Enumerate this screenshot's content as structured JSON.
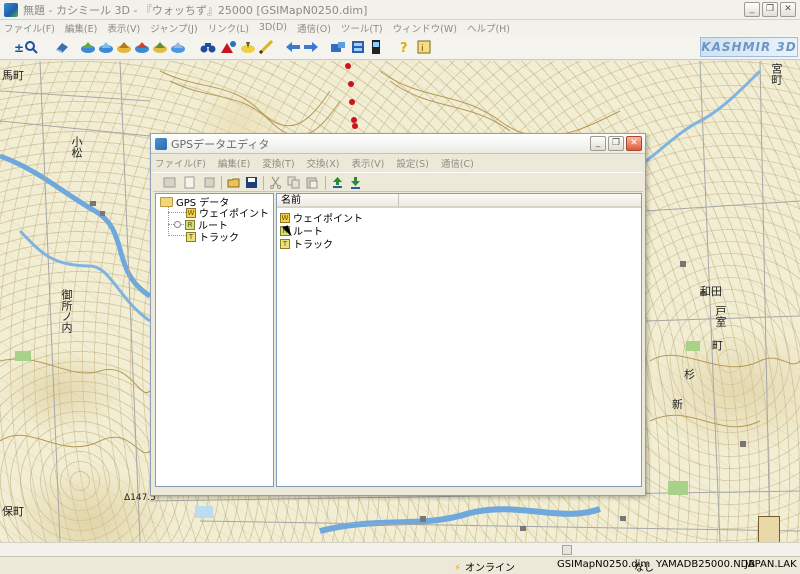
{
  "window": {
    "title": "無題 - カシミール 3D - 『ウォッちず』25000 [GSIMapN0250.dim]",
    "buttons": [
      "_",
      "❐",
      "✕"
    ]
  },
  "menu": [
    "ファイル(F)",
    "編集(E)",
    "表示(V)",
    "ジャンプ(J)",
    "リンク(L)",
    "3D(D)",
    "通信(O)",
    "ツール(T)",
    "ウィンドウ(W)",
    "ヘルプ(H)"
  ],
  "brand": "KASHMIR 3D",
  "map": {
    "labels": [
      "馬町",
      "小松",
      "御所ノ内",
      "保町",
      "宮町",
      "和田",
      "戸室",
      "町",
      "Δ147.5",
      "杉",
      "新"
    ]
  },
  "dialog": {
    "title": "GPSデータエディタ",
    "menu": [
      "ファイル(F)",
      "編集(E)",
      "変換(T)",
      "交換(X)",
      "表示(V)",
      "設定(S)",
      "通信(C)"
    ],
    "tree": {
      "root": "GPS データ",
      "children": [
        "ウェイポイント",
        "ルート",
        "トラック"
      ]
    },
    "list": {
      "column_header": "名前",
      "rows": [
        "ウェイポイント",
        "ルート",
        "トラック"
      ]
    }
  },
  "status": {
    "connection": "オンライン",
    "file": "GSIMapN0250.dim",
    "none": "なし",
    "db": "YAMADB25000.NDB",
    "lak": "JAPAN.LAK"
  },
  "colors": {
    "route": "#c8141e",
    "map_bg": "#f2eed3"
  }
}
